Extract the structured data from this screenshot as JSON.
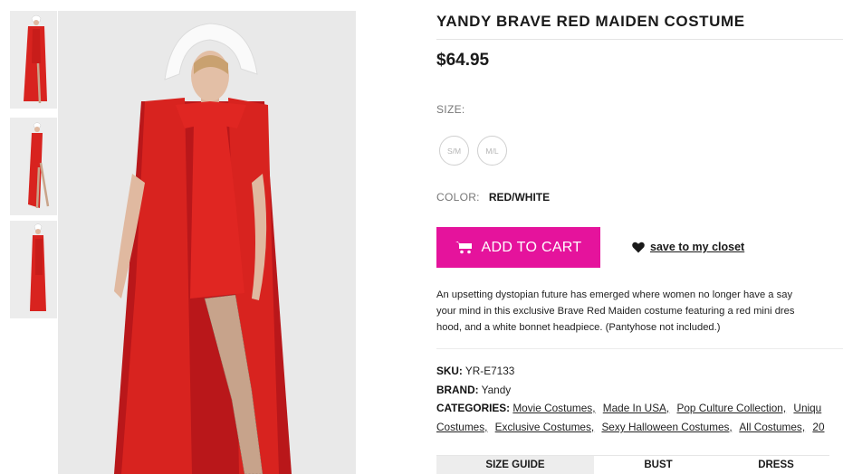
{
  "product": {
    "title": "YANDY BRAVE RED MAIDEN COSTUME",
    "price": "$64.95",
    "size_label": "SIZE:",
    "sizes": [
      "S/M",
      "M/L"
    ],
    "color_label": "COLOR:",
    "color_value": "RED/WHITE",
    "add_to_cart": "ADD TO CART",
    "save_closet": "save to my closet",
    "description_lines": [
      "An upsetting dystopian future has emerged where women no longer have a say",
      "your mind in this exclusive Brave Red Maiden costume featuring a red mini dres",
      "hood, and a white bonnet headpiece. (Pantyhose not included.)"
    ],
    "sku_label": "SKU:",
    "sku": "YR-E7133",
    "brand_label": "BRAND:",
    "brand": "Yandy",
    "categories_label": "CATEGORIES:",
    "categories_line1": [
      "Movie Costumes,",
      "Made In USA,",
      "Pop Culture Collection,",
      "Uniqu"
    ],
    "categories_line2": [
      "Costumes,",
      "Exclusive Costumes,",
      "Sexy Halloween Costumes,",
      "All Costumes,",
      "20"
    ]
  },
  "tabs": [
    "SIZE GUIDE",
    "BUST",
    "DRESS"
  ],
  "icons": [
    "cart-icon",
    "heart-icon"
  ],
  "colors": {
    "accent": "#e5139c",
    "costume_red": "#d8231f",
    "text": "#1a1a1a",
    "muted": "#777777"
  }
}
